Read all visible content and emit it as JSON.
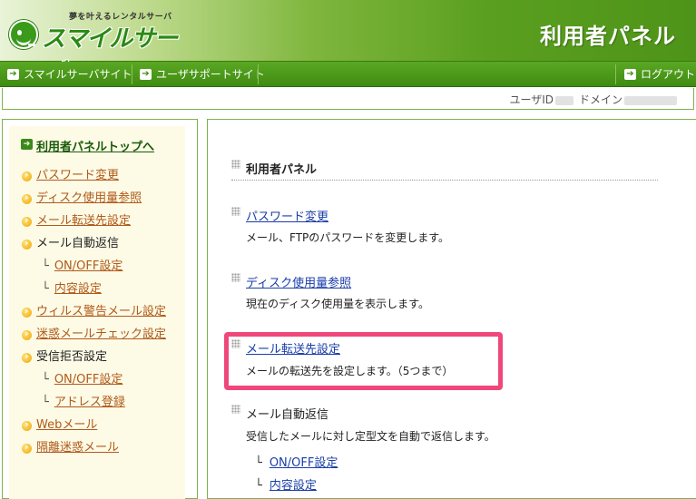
{
  "header": {
    "tagline": "夢を叶えるレンタルサーバ",
    "logo_text": "スマイルサーバ",
    "panel_title": "利用者パネル"
  },
  "nav": {
    "items": [
      {
        "label": "スマイルサーバサイト",
        "icon": "arrow-right-icon"
      },
      {
        "label": "ユーザサポートサイト",
        "icon": "arrow-right-icon"
      }
    ],
    "logout": {
      "label": "ログアウト",
      "icon": "arrow-right-icon"
    }
  },
  "userbar": {
    "user_label": "ユーザID",
    "domain_label": "ドメイン"
  },
  "sidebar": {
    "top_link": "利用者パネルトップへ",
    "items": [
      {
        "label": "パスワード変更",
        "type": "link"
      },
      {
        "label": "ディスク使用量参照",
        "type": "link"
      },
      {
        "label": "メール転送先設定",
        "type": "link"
      },
      {
        "label": "メール自動返信",
        "type": "plain"
      },
      {
        "label": "ON/OFF設定",
        "type": "sub"
      },
      {
        "label": "内容設定",
        "type": "sub"
      },
      {
        "label": "ウィルス警告メール設定",
        "type": "link"
      },
      {
        "label": "迷惑メールチェック設定",
        "type": "link"
      },
      {
        "label": "受信拒否設定",
        "type": "plain"
      },
      {
        "label": "ON/OFF設定",
        "type": "sub"
      },
      {
        "label": "アドレス登録",
        "type": "sub"
      },
      {
        "label": "Webメール",
        "type": "link"
      },
      {
        "label": "隔離迷惑メール",
        "type": "link"
      }
    ],
    "corner_glyph": "└"
  },
  "main": {
    "heading": "利用者パネル",
    "sections": [
      {
        "title": "パスワード変更",
        "desc": "メール、FTPのパスワードを変更します。"
      },
      {
        "title": "ディスク使用量参照",
        "desc": "現在のディスク使用量を表示します。"
      },
      {
        "title": "メール転送先設定",
        "desc": "メールの転送先を設定します。（5つまで）"
      },
      {
        "title": "メール自動返信",
        "desc": "受信したメールに対し定型文を自動で返信します。"
      }
    ],
    "auto_reply_subs": [
      "ON/OFF設定",
      "内容設定"
    ]
  },
  "colors": {
    "brand_green": "#3f8b12",
    "link_orange": "#b05a1a",
    "link_blue": "#1a3ea8",
    "highlight_pink": "#f0477a"
  }
}
